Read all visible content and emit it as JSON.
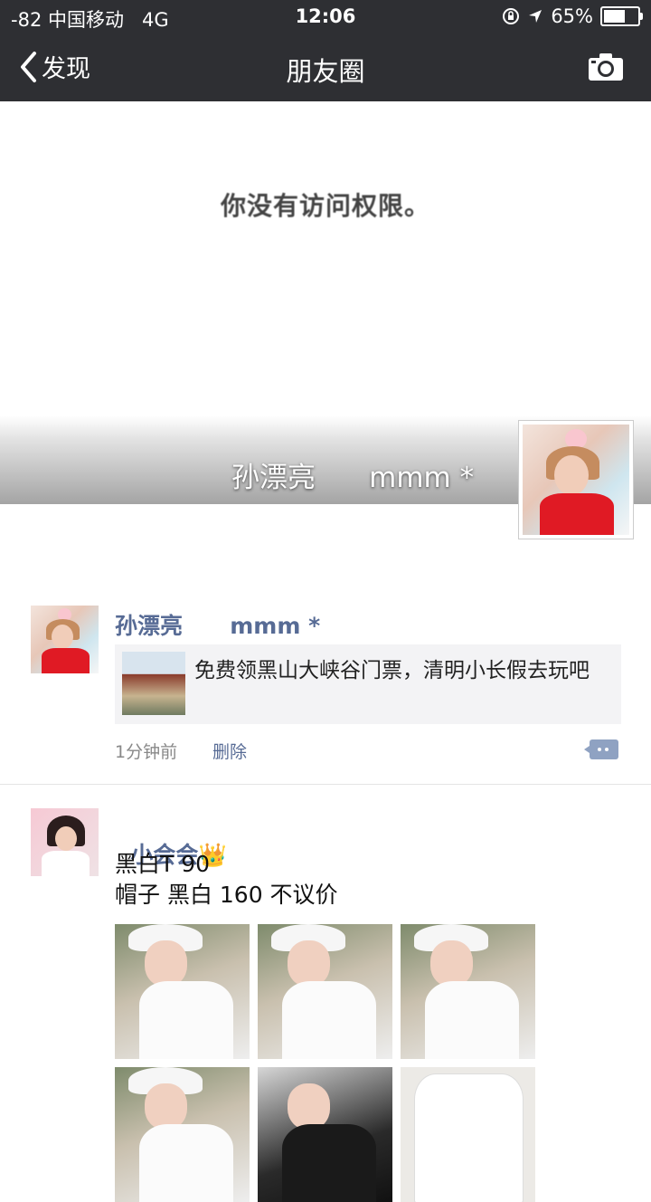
{
  "status_bar": {
    "signal": "-82",
    "carrier": "中国移动",
    "network": "4G",
    "time": "12:06",
    "battery_percent_label": "65%",
    "battery_level": 0.65
  },
  "nav": {
    "back_label": "发现",
    "title": "朋友圈"
  },
  "cover": {
    "no_access_text": "你没有访问权限。",
    "profile_name": "孙漂亮      mmm *"
  },
  "posts": [
    {
      "author": "孙漂亮      mmm *",
      "link_title": "免费领黑山大峡谷门票，清明小长假去玩吧",
      "time": "1分钟前",
      "delete_label": "删除"
    },
    {
      "author": "小会会",
      "author_emoji": "👑",
      "lines": [
        "黑白T 90",
        "帽子 黑白 160 不议价"
      ],
      "image_count": 6
    }
  ],
  "colors": {
    "bar_bg": "#2e2f33",
    "link_blue": "#576b95",
    "card_bg": "#f3f3f5"
  },
  "icons": [
    "back-chevron-icon",
    "camera-icon",
    "comment-icon",
    "crown-icon"
  ]
}
